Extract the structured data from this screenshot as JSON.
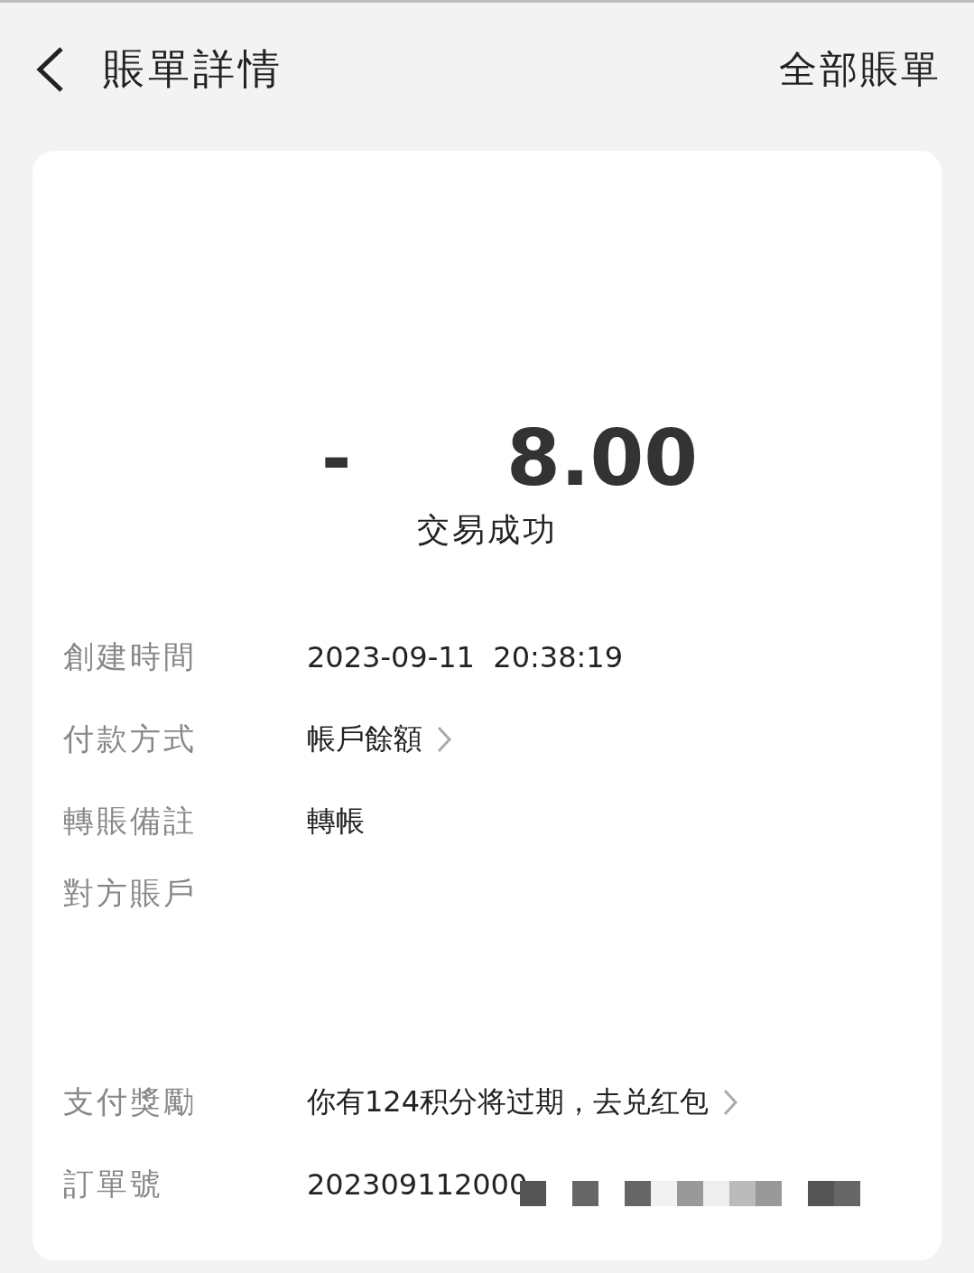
{
  "header": {
    "title": "賬單詳情",
    "action": "全部賬單"
  },
  "amount": {
    "sign": "-",
    "value": "8.00"
  },
  "status": "交易成功",
  "details": [
    {
      "label": "創建時間",
      "value": "2023-09-11  20:38:19",
      "link": false
    },
    {
      "label": "付款方式",
      "value": "帳戶餘額",
      "link": true
    },
    {
      "label": "轉賬備註",
      "value": "轉帳",
      "link": false
    },
    {
      "label": "對方賬戶"
    },
    {
      "label": "支付獎勵",
      "value": "你有124积分将过期，去兑红包",
      "link": true
    },
    {
      "label": "訂單號",
      "value": "202309112000",
      "link": false,
      "masked": true
    }
  ]
}
